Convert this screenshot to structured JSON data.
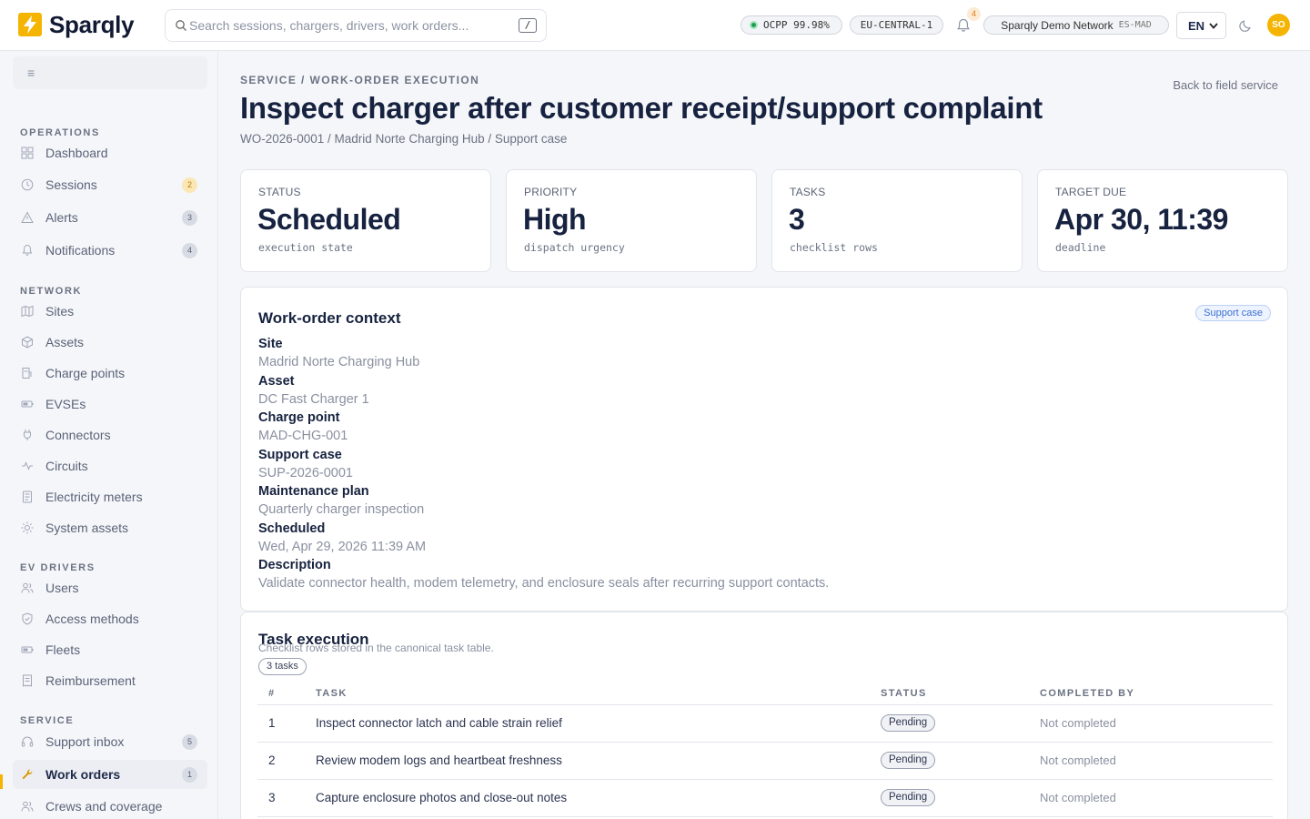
{
  "brand": {
    "name": "Sparqly",
    "accent": "#f5b400"
  },
  "search": {
    "placeholder": "Search sessions, chargers, drivers, work orders...",
    "shortcut": "/"
  },
  "header": {
    "ocpp_status": "OCPP 99.98%",
    "region": "EU-CENTRAL-1",
    "notifications_count": "4",
    "network_name": "Sparqly Demo Network",
    "network_code": "ES-MAD",
    "language": "EN",
    "avatar_initials": "SO"
  },
  "sidebar": {
    "sections": [
      {
        "label": "OPERATIONS",
        "items": [
          {
            "label": "Dashboard",
            "icon": "grid-icon"
          },
          {
            "label": "Sessions",
            "icon": "clock-icon",
            "count": "2",
            "count_style": "warn"
          },
          {
            "label": "Alerts",
            "icon": "warning-icon",
            "count": "3"
          },
          {
            "label": "Notifications",
            "icon": "bell-icon",
            "count": "4"
          }
        ]
      },
      {
        "label": "NETWORK",
        "items": [
          {
            "label": "Sites",
            "icon": "map-icon"
          },
          {
            "label": "Assets",
            "icon": "cube-icon"
          },
          {
            "label": "Charge points",
            "icon": "fuel-icon"
          },
          {
            "label": "EVSEs",
            "icon": "battery-icon"
          },
          {
            "label": "Connectors",
            "icon": "plug-icon"
          },
          {
            "label": "Circuits",
            "icon": "pulse-icon"
          },
          {
            "label": "Electricity meters",
            "icon": "meter-icon"
          },
          {
            "label": "System assets",
            "icon": "sun-icon"
          }
        ]
      },
      {
        "label": "EV DRIVERS",
        "items": [
          {
            "label": "Users",
            "icon": "users-icon"
          },
          {
            "label": "Access methods",
            "icon": "shield-icon"
          },
          {
            "label": "Fleets",
            "icon": "battery-icon"
          },
          {
            "label": "Reimbursement",
            "icon": "receipt-icon"
          }
        ]
      },
      {
        "label": "SERVICE",
        "items": [
          {
            "label": "Support inbox",
            "icon": "headset-icon",
            "count": "5"
          },
          {
            "label": "Work orders",
            "icon": "wrench-icon",
            "count": "1",
            "active": true
          },
          {
            "label": "Crews and coverage",
            "icon": "users-icon"
          }
        ]
      }
    ]
  },
  "page": {
    "breadcrumb": "SERVICE / WORK-ORDER EXECUTION",
    "title": "Inspect charger after customer receipt/support complaint",
    "subtitle": "WO-2026-0001 / Madrid Norte Charging Hub / Support case",
    "back_link": "Back to field service"
  },
  "kpis": [
    {
      "label": "STATUS",
      "value": "Scheduled",
      "hint": "execution state"
    },
    {
      "label": "PRIORITY",
      "value": "High",
      "hint": "dispatch urgency"
    },
    {
      "label": "TASKS",
      "value": "3",
      "hint": "checklist rows"
    },
    {
      "label": "TARGET DUE",
      "value": "Apr 30, 11:39",
      "hint": "deadline"
    }
  ],
  "context": {
    "title": "Work-order context",
    "tag": "Support case",
    "fields": [
      {
        "label": "Site",
        "value": "Madrid Norte Charging Hub"
      },
      {
        "label": "Asset",
        "value": "DC Fast Charger 1"
      },
      {
        "label": "Charge point",
        "value": "MAD-CHG-001"
      },
      {
        "label": "Support case",
        "value": "SUP-2026-0001"
      },
      {
        "label": "Maintenance plan",
        "value": "Quarterly charger inspection"
      },
      {
        "label": "Scheduled",
        "value": "Wed, Apr 29, 2026 11:39 AM"
      },
      {
        "label": "Description",
        "value": "Validate connector health, modem telemetry, and enclosure seals after recurring support contacts."
      }
    ]
  },
  "tasks": {
    "title": "Task execution",
    "subtitle": "Checklist rows stored in the canonical task table.",
    "count_label": "3 tasks",
    "columns": [
      "#",
      "TASK",
      "STATUS",
      "COMPLETED BY"
    ],
    "rows": [
      {
        "num": "1",
        "task": "Inspect connector latch and cable strain relief",
        "status": "Pending",
        "completed_by": "Not completed"
      },
      {
        "num": "2",
        "task": "Review modem logs and heartbeat freshness",
        "status": "Pending",
        "completed_by": "Not completed"
      },
      {
        "num": "3",
        "task": "Capture enclosure photos and close-out notes",
        "status": "Pending",
        "completed_by": "Not completed"
      }
    ]
  }
}
